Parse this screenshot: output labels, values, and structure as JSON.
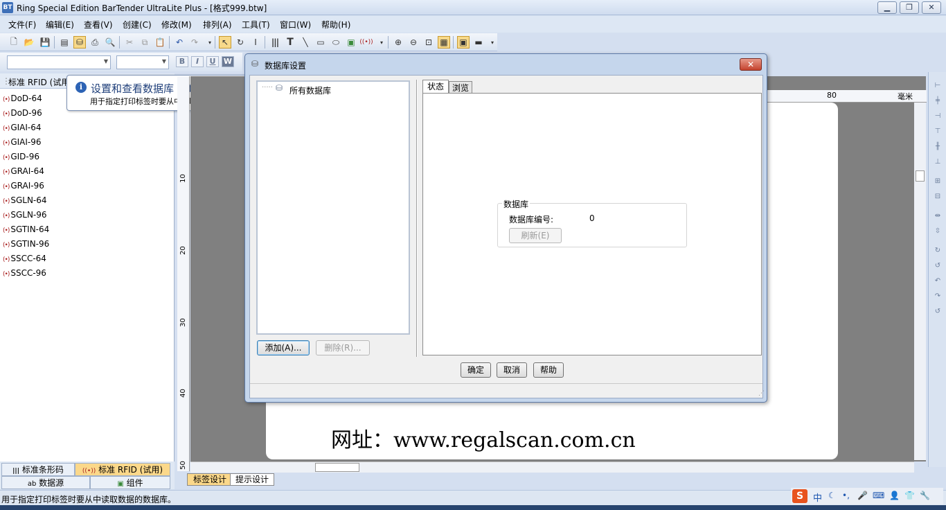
{
  "window": {
    "title": "Ring Special Edition BarTender UltraLite Plus - [格式999.btw]",
    "app_icon": "bartender-logo-icon"
  },
  "menu": [
    "文件(F)",
    "编辑(E)",
    "查看(V)",
    "创建(C)",
    "修改(M)",
    "排列(A)",
    "工具(T)",
    "窗口(W)",
    "帮助(H)"
  ],
  "toolbar": {
    "icons": [
      "new-file-icon",
      "open-folder-icon",
      "save-icon",
      "page-setup-icon",
      "database-icon",
      "print-icon",
      "print-preview-icon",
      "cut-icon",
      "copy-icon",
      "paste-icon",
      "undo-icon",
      "redo-icon",
      "select-pointer-icon",
      "rotate-icon",
      "text-cursor-icon",
      "barcode-icon",
      "text-tool-icon",
      "line-tool-icon",
      "rectangle-tool-icon",
      "ellipse-tool-icon",
      "image-tool-icon",
      "rfid-tool-icon",
      "zoom-in-icon",
      "zoom-out-icon",
      "zoom-fit-icon",
      "ruler-icon",
      "card-icon",
      "encoder-icon"
    ],
    "format": {
      "bold": "B",
      "italic": "I",
      "underline": "U",
      "wordart": "W"
    }
  },
  "left_panel": {
    "header": "标准 RFID (试用)",
    "items": [
      "DoD-64",
      "DoD-96",
      "GIAI-64",
      "GIAI-96",
      "GID-96",
      "GRAI-64",
      "GRAI-96",
      "SGLN-64",
      "SGLN-96",
      "SGTIN-64",
      "SGTIN-96",
      "SSCC-64",
      "SSCC-96"
    ],
    "item_icon": "(•)",
    "bottom_tabs": [
      "标准条形码",
      "标准 RFID (试用)",
      "数据源",
      "组件"
    ]
  },
  "tooltip": {
    "title": "设置和查看数据库 (Ctrl+D)",
    "description": "用于指定打印标签时要从中读取数据的数据库。"
  },
  "canvas": {
    "website_text": "网址：www.regalscan.com.cn",
    "ruler_top_value": "80",
    "ruler_unit": "毫米",
    "ruler_left_values": [
      "10",
      "20",
      "30",
      "40",
      "50"
    ],
    "design_tabs": [
      "标签设计",
      "提示设计"
    ]
  },
  "dialog": {
    "title": "数据库设置",
    "tree_root": "所有数据库",
    "add_button": "添加(A)...",
    "delete_button": "删除(R)...",
    "tabs": [
      "状态",
      "浏览"
    ],
    "group_title": "数据库",
    "db_count_label": "数据库编号:",
    "db_count_value": "0",
    "refresh_button": "刷新(E)",
    "ok_button": "确定",
    "cancel_button": "取消",
    "help_button": "帮助"
  },
  "statusbar": {
    "text": "用于指定打印标签时要从中读取数据的数据库。"
  },
  "ime": {
    "mode": "中"
  }
}
